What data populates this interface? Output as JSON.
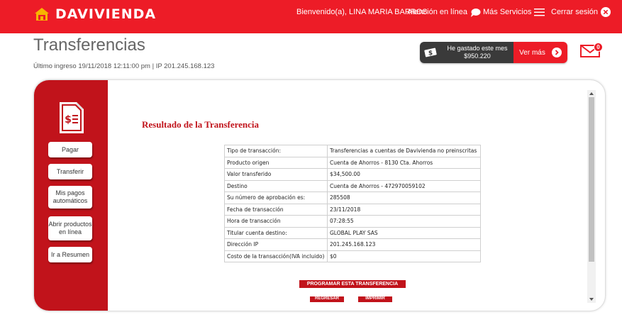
{
  "brand": {
    "name": "DAVIVIENDA",
    "primary": "#ed1c27",
    "dark": "#c1131b"
  },
  "header": {
    "welcome": "Bienvenido(a), LINA MARIA BARROS",
    "help": "Atención en línea",
    "more": "Más Servicios",
    "logout": "Cerrar sesión"
  },
  "page": {
    "title": "Transferencias",
    "last_login": "Último ingreso 19/11/2018 12:11:00 pm | IP 201.245.168.123"
  },
  "spending": {
    "label": "He gastado este mes",
    "amount": "$950.220",
    "cta": "Ver más"
  },
  "messages": {
    "count": "0"
  },
  "sidebar": {
    "items": [
      {
        "label": "Pagar"
      },
      {
        "label": "Transferir"
      },
      {
        "label": "Mis pagos automáticos"
      },
      {
        "label": "Abrir productos en línea"
      },
      {
        "label": "Ir a Resumen"
      }
    ]
  },
  "result": {
    "title": "Resultado de la Transferencia",
    "rows": [
      {
        "key": "Tipo de transacción:",
        "value": "Transferencias a cuentas de Davivienda no preinscritas"
      },
      {
        "key": "Producto origen",
        "value": "Cuenta de Ahorros - 8130 Cta. Ahorros"
      },
      {
        "key": "Valor transferido",
        "value": "$34,500.00"
      },
      {
        "key": "Destino",
        "value": "Cuenta de Ahorros - 472970059102"
      },
      {
        "key": "Su número de aprobación es:",
        "value": "285508"
      },
      {
        "key": "Fecha de transacción",
        "value": "23/11/2018"
      },
      {
        "key": "Hora de transacción",
        "value": "07:28:55"
      },
      {
        "key": "Titular cuenta destino:",
        "value": "GLOBAL PLAY SAS"
      },
      {
        "key": "Dirección IP",
        "value": "201.245.168.123"
      },
      {
        "key": "Costo de la transacción(IVA incluido)",
        "value": "$0"
      }
    ],
    "program_button": "PROGRAMAR ESTA TRANSFERENCIA",
    "back_button": "REGRESAR",
    "print_button": "IMPRIMIR"
  }
}
